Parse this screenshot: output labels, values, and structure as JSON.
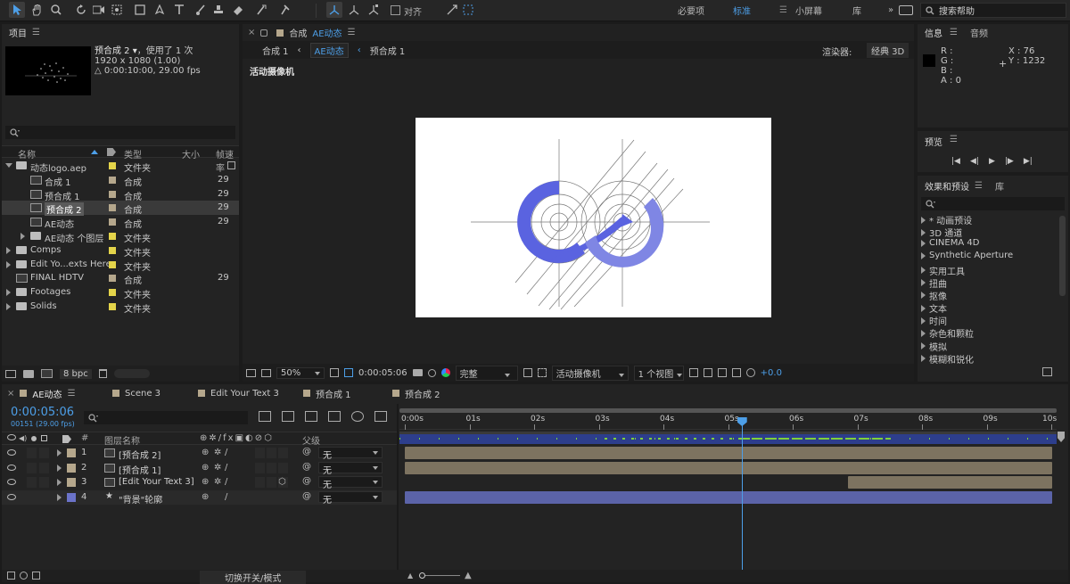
{
  "toolbar": {
    "align_label": "对齐",
    "workspaces": [
      "必要项",
      "标准",
      "小屏幕",
      "库"
    ],
    "active_workspace": "标准",
    "search_placeholder": "搜索帮助"
  },
  "project": {
    "title": "项目",
    "comp_name": "预合成 2 ▾",
    "used": "，使用了 1 次",
    "resolution": "1920 x 1080 (1.00)",
    "duration": "△ 0:00:10:00, 29.00 fps",
    "col_name": "名称",
    "col_type": "类型",
    "col_size": "大小",
    "col_fps": "帧速率",
    "bpc": "8 bpc",
    "items": [
      {
        "name": "动态logo.aep",
        "type": "文件夹",
        "fps": "",
        "color": "#e4d44a",
        "icon": "folder",
        "indent": 0,
        "arrow": "down"
      },
      {
        "name": "合成 1",
        "type": "合成",
        "fps": "29",
        "color": "#b5a78c",
        "icon": "comp",
        "indent": 1,
        "arrow": ""
      },
      {
        "name": "预合成 1",
        "type": "合成",
        "fps": "29",
        "color": "#b5a78c",
        "icon": "comp",
        "indent": 1,
        "arrow": ""
      },
      {
        "name": "预合成 2",
        "type": "合成",
        "fps": "29",
        "color": "#b5a78c",
        "icon": "comp",
        "indent": 1,
        "arrow": "",
        "selected": true
      },
      {
        "name": "AE动态",
        "type": "合成",
        "fps": "29",
        "color": "#b5a78c",
        "icon": "comp",
        "indent": 1,
        "arrow": ""
      },
      {
        "name": "AE动态 个图层",
        "type": "文件夹",
        "fps": "",
        "color": "#e4d44a",
        "icon": "folder",
        "indent": 1,
        "arrow": "right"
      },
      {
        "name": "Comps",
        "type": "文件夹",
        "fps": "",
        "color": "#e4d44a",
        "icon": "folder",
        "indent": 0,
        "arrow": "right"
      },
      {
        "name": "Edit Yo...exts Here",
        "type": "文件夹",
        "fps": "",
        "color": "#e4d44a",
        "icon": "folder",
        "indent": 0,
        "arrow": "right"
      },
      {
        "name": "FINAL HDTV",
        "type": "合成",
        "fps": "29",
        "color": "#b5a78c",
        "icon": "comp",
        "indent": 0,
        "arrow": ""
      },
      {
        "name": "Footages",
        "type": "文件夹",
        "fps": "",
        "color": "#e4d44a",
        "icon": "folder",
        "indent": 0,
        "arrow": "right"
      },
      {
        "name": "Solids",
        "type": "文件夹",
        "fps": "",
        "color": "#e4d44a",
        "icon": "folder",
        "indent": 0,
        "arrow": "right"
      }
    ]
  },
  "viewer": {
    "tab_prefix": "合成",
    "tab_name": "AE动态",
    "breadcrumbs": [
      "合成 1",
      "AE动态",
      "预合成 1"
    ],
    "renderer_label": "渲染器:",
    "renderer_value": "经典 3D",
    "camera_label": "活动摄像机",
    "zoom": "50%",
    "timecode": "0:00:05:06",
    "resolution": "完整",
    "camera": "活动摄像机",
    "views": "1 个视图",
    "exposure": "+0.0"
  },
  "info": {
    "tab": "信息",
    "tab2": "音频",
    "r": "R :",
    "g": "G :",
    "b": "B :",
    "a": "A : 0",
    "x": "X : 76",
    "y": "Y : 1232"
  },
  "preview": {
    "title": "预览"
  },
  "effects": {
    "tab": "效果和预设",
    "tab2": "库",
    "items": [
      "* 动画预设",
      "3D 通道",
      "CINEMA 4D",
      "Synthetic Aperture",
      "实用工具",
      "扭曲",
      "抠像",
      "文本",
      "时间",
      "杂色和颗粒",
      "模拟",
      "模糊和锐化"
    ]
  },
  "timeline": {
    "tabs": [
      "AE动态",
      "Scene 3",
      "Edit Your Text 3",
      "预合成 1",
      "预合成 2"
    ],
    "tab_colors": [
      "#b5a78c",
      "#b5a78c",
      "#b5a78c",
      "#b5a78c",
      "#b5a78c"
    ],
    "timecode": "0:00:05:06",
    "frames": "00151 (29.00 fps)",
    "col_num": "#",
    "col_name": "图层名称",
    "col_parent": "父级",
    "ruler": [
      "0:00s",
      "01s",
      "02s",
      "03s",
      "04s",
      "05s",
      "06s",
      "07s",
      "08s",
      "09s",
      "10s"
    ],
    "current_time_s": 5.21,
    "toggle_label": "切换开关/模式",
    "layers": [
      {
        "num": "1",
        "name": "[预合成 2]",
        "color": "#b5a78c",
        "parent": "无",
        "bar_start_s": 0,
        "bar_color": "#7d7360"
      },
      {
        "num": "2",
        "name": "[预合成 1]",
        "color": "#b5a78c",
        "parent": "无",
        "bar_start_s": 0,
        "bar_color": "#7d7360"
      },
      {
        "num": "3",
        "name": "[Edit Your Text 3]",
        "color": "#b5a78c",
        "parent": "无",
        "bar_start_s": 6.85,
        "bar_color": "#7d7360"
      },
      {
        "num": "4",
        "name": "\"背景\"轮廓",
        "color": "#6b73c9",
        "parent": "无",
        "bar_start_s": 0,
        "bar_color": "#5b63a8"
      }
    ]
  }
}
